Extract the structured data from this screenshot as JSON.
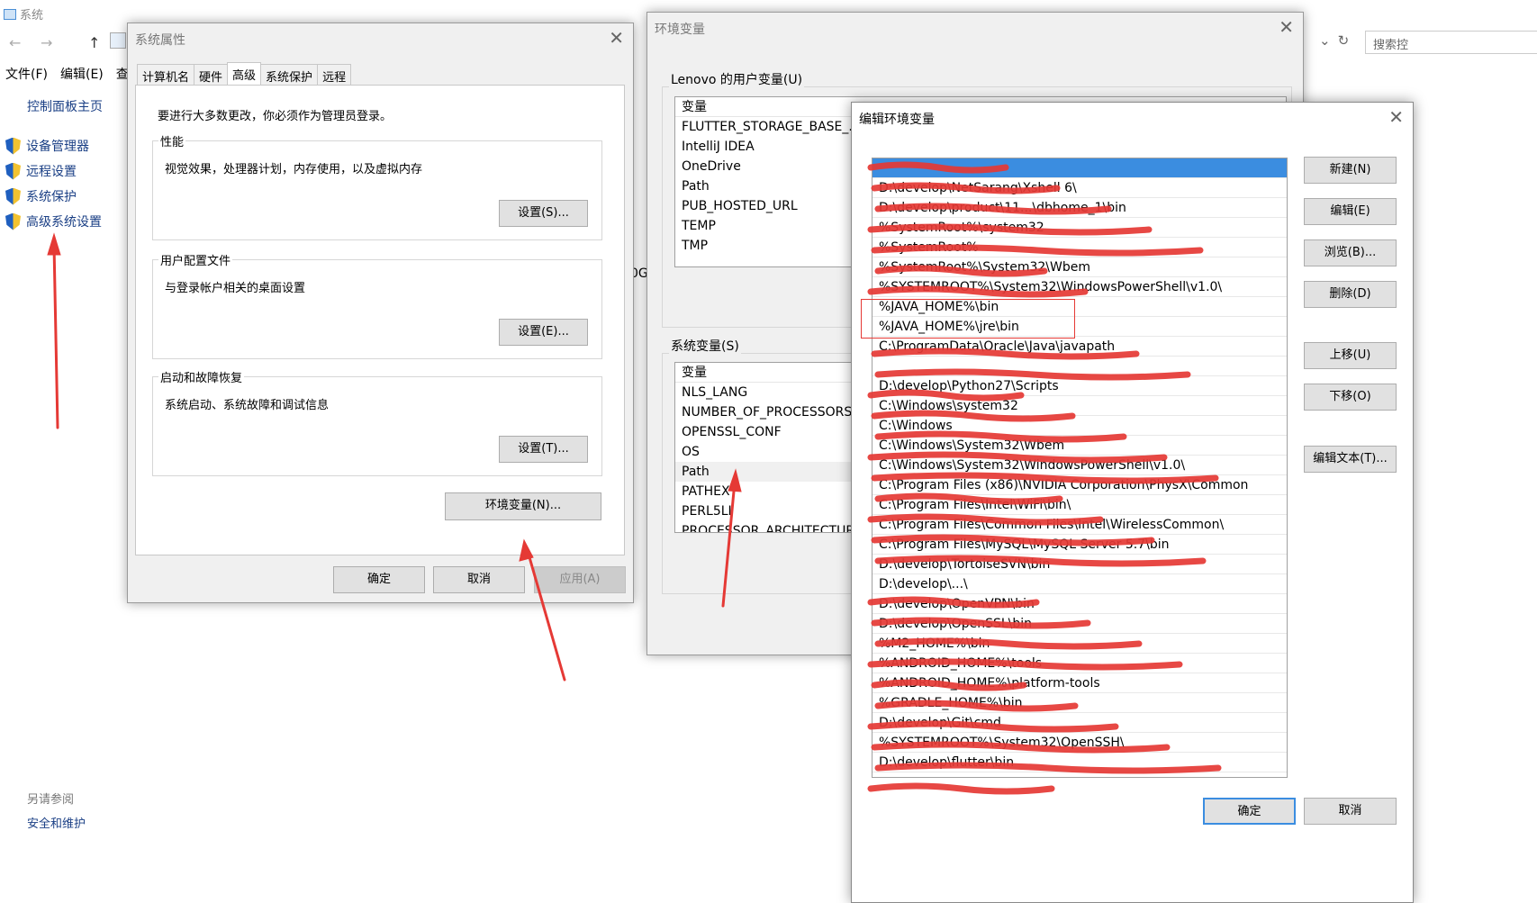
{
  "control_panel": {
    "window_title": "系统",
    "menu": [
      "文件(F)",
      "编辑(E)",
      "查看"
    ],
    "home_link": "控制面板主页",
    "links": [
      "设备管理器",
      "远程设置",
      "系统保护",
      "高级系统设置"
    ],
    "see_also": "另请参阅",
    "see_also_link": "安全和维护",
    "search_placeholder": "搜索控",
    "partial_text": "0G"
  },
  "system_properties": {
    "title": "系统属性",
    "close": "✕",
    "tabs": [
      "计算机名",
      "硬件",
      "高级",
      "系统保护",
      "远程"
    ],
    "active_tab": "高级",
    "admin_note": "要进行大多数更改，你必须作为管理员登录。",
    "performance": {
      "label": "性能",
      "desc": "视觉效果，处理器计划，内存使用，以及虚拟内存",
      "button": "设置(S)..."
    },
    "user_profiles": {
      "label": "用户配置文件",
      "desc": "与登录帐户相关的桌面设置",
      "button": "设置(E)..."
    },
    "startup_recovery": {
      "label": "启动和故障恢复",
      "desc": "系统启动、系统故障和调试信息",
      "button": "设置(T)..."
    },
    "env_button": "环境变量(N)...",
    "ok": "确定",
    "cancel": "取消",
    "apply": "应用(A)"
  },
  "environment_variables": {
    "title": "环境变量",
    "close": "✕",
    "user_section": "Lenovo 的用户变量(U)",
    "user_header": "变量",
    "user_vars": [
      "FLUTTER_STORAGE_BASE_...",
      "IntelliJ IDEA",
      "OneDrive",
      "Path",
      "PUB_HOSTED_URL",
      "TEMP",
      "TMP"
    ],
    "system_section": "系统变量(S)",
    "system_header": "变量",
    "system_vars": [
      "NLS_LANG",
      "NUMBER_OF_PROCESSORS",
      "OPENSSL_CONF",
      "OS",
      "Path",
      "PATHEX",
      "PERL5LI",
      "PROCESSOR_ARCHITECTURE"
    ],
    "selected_system_var": "Path"
  },
  "edit_environment_variable": {
    "title": "编辑环境变量",
    "close": "✕",
    "entries": [
      "",
      "D:\\develop\\NetSarang\\Xshell 6\\",
      "D:\\develop\\product\\11...\\dbhome_1\\bin",
      "%SystemRoot%\\system32",
      "%SystemRoot%",
      "%SystemRoot%\\System32\\Wbem",
      "%SYSTEMROOT%\\System32\\WindowsPowerShell\\v1.0\\",
      "%JAVA_HOME%\\bin",
      "%JAVA_HOME%\\jre\\bin",
      "C:\\ProgramData\\Oracle\\Java\\javapath",
      "",
      "D:\\develop\\Python27\\Scripts",
      "C:\\Windows\\system32",
      "C:\\Windows",
      "C:\\Windows\\System32\\Wbem",
      "C:\\Windows\\System32\\WindowsPowerShell\\v1.0\\",
      "C:\\Program Files (x86)\\NVIDIA Corporation\\PhysX\\Common",
      "C:\\Program Files\\Intel\\WiFi\\bin\\",
      "C:\\Program Files\\Common Files\\Intel\\WirelessCommon\\",
      "C:\\Program Files\\MySQL\\MySQL Server 5.7\\bin",
      "D:\\develop\\TortoiseSVN\\bin",
      "D:\\develop\\...\\",
      "D:\\develop\\OpenVPN\\bin",
      "D:\\develop\\OpenSSL\\bin",
      "%M2_HOME%\\bin",
      "%ANDROID_HOME%\\tools",
      "%ANDROID_HOME%\\platform-tools",
      "%GRADLE_HOME%\\bin",
      "D:\\develop\\Git\\cmd",
      "%SYSTEMROOT%\\System32\\OpenSSH\\",
      "D:\\develop\\flutter\\bin"
    ],
    "buttons": [
      "新建(N)",
      "编辑(E)",
      "浏览(B)...",
      "删除(D)",
      "上移(U)",
      "下移(O)",
      "编辑文本(T)..."
    ],
    "ok": "确定",
    "cancel": "取消"
  },
  "colors": {
    "annotation": "#e53935",
    "selection": "#3b8de0"
  }
}
